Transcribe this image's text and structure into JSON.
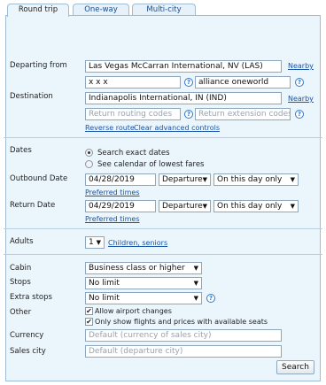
{
  "tabs": [
    {
      "label": "Round trip",
      "active": true
    },
    {
      "label": "One-way",
      "active": false
    },
    {
      "label": "Multi-city",
      "active": false
    }
  ],
  "departing": {
    "label": "Departing from",
    "value": "Las Vegas McCarran International, NV (LAS)",
    "nearby_link": "Nearby",
    "routing_value": "x x x",
    "extension_value": "alliance oneworld"
  },
  "destination": {
    "label": "Destination",
    "value": "Indianapolis International, IN (IND)",
    "nearby_link": "Nearby",
    "routing_placeholder": "Return routing codes",
    "extension_placeholder": "Return extension codes"
  },
  "links": {
    "reverse_route": "Reverse route",
    "clear_advanced": "Clear advanced controls"
  },
  "dates": {
    "label": "Dates",
    "option_exact": "Search exact dates",
    "option_calendar": "See calendar of lowest fares",
    "selected": "exact"
  },
  "outbound": {
    "label": "Outbound Date",
    "date": "04/28/2019",
    "time_mode": "Departure",
    "flex": "On this day only",
    "preferred_times": "Preferred times"
  },
  "return": {
    "label": "Return Date",
    "date": "04/29/2019",
    "time_mode": "Departure",
    "flex": "On this day only",
    "preferred_times": "Preferred times"
  },
  "adults": {
    "label": "Adults",
    "value": "1",
    "children_link": "Children, seniors"
  },
  "cabin": {
    "label": "Cabin",
    "value": "Business class or higher"
  },
  "stops": {
    "label": "Stops",
    "value": "No limit"
  },
  "extra_stops": {
    "label": "Extra stops",
    "value": "No limit"
  },
  "other": {
    "label": "Other",
    "allow_airport_changes": "Allow airport changes",
    "only_available_seats": "Only show flights and prices with available seats"
  },
  "currency": {
    "label": "Currency",
    "placeholder": "Default (currency of sales city)"
  },
  "sales_city": {
    "label": "Sales city",
    "placeholder": "Default (departure city)"
  },
  "search_button": "Search",
  "icons": {
    "help": "?",
    "dropdown": "▼",
    "check": "✔"
  },
  "colors": {
    "panel_bg": "#eaf5fc",
    "border": "#9fbcd4",
    "link": "#1a55a8"
  }
}
